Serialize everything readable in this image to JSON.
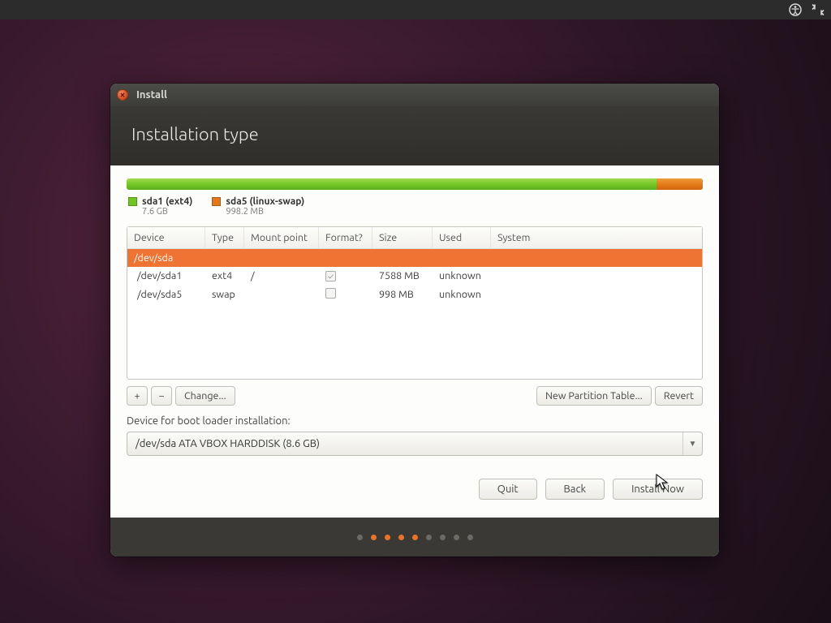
{
  "topbar": {
    "icons": [
      "accessibility",
      "network"
    ]
  },
  "window": {
    "title": "Install",
    "header": "Installation type"
  },
  "legend": [
    {
      "name": "sda1 (ext4)",
      "size": "7.6 GB",
      "color": "green"
    },
    {
      "name": "sda5 (linux-swap)",
      "size": "998.2 MB",
      "color": "orange"
    }
  ],
  "table": {
    "columns": [
      "Device",
      "Type",
      "Mount point",
      "Format?",
      "Size",
      "Used",
      "System"
    ],
    "rows": [
      {
        "device": "/dev/sda",
        "type": "",
        "mount": "",
        "format": null,
        "size": "",
        "used": "",
        "system": "",
        "selected": true,
        "indent": 0
      },
      {
        "device": "/dev/sda1",
        "type": "ext4",
        "mount": "/",
        "format": true,
        "size": "7588 MB",
        "used": "unknown",
        "system": "",
        "selected": false,
        "indent": 1
      },
      {
        "device": "/dev/sda5",
        "type": "swap",
        "mount": "",
        "format": false,
        "size": "998 MB",
        "used": "unknown",
        "system": "",
        "selected": false,
        "indent": 1
      }
    ]
  },
  "toolbar": {
    "add": "+",
    "remove": "−",
    "change": "Change...",
    "newtable": "New Partition Table...",
    "revert": "Revert"
  },
  "boot": {
    "label": "Device for boot loader installation:",
    "selected": "/dev/sda   ATA VBOX HARDDISK (8.6 GB)"
  },
  "footer": {
    "quit": "Quit",
    "back": "Back",
    "install": "Install Now"
  },
  "pager": {
    "total": 9,
    "active": [
      1,
      2,
      3,
      4
    ]
  }
}
